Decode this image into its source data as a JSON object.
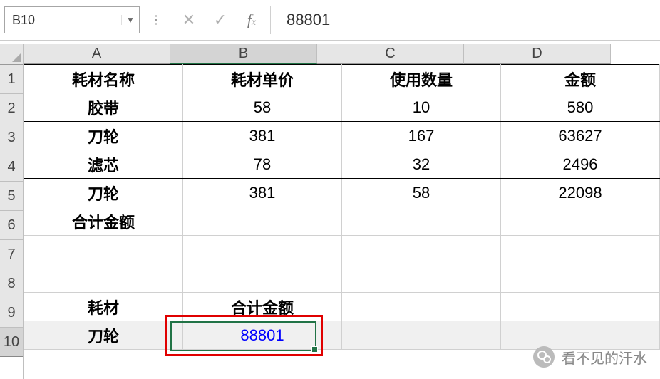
{
  "namebox": "B10",
  "formula_value": "88801",
  "col_labels": [
    "A",
    "B",
    "C",
    "D"
  ],
  "row_labels": [
    "1",
    "2",
    "3",
    "4",
    "5",
    "6",
    "7",
    "8",
    "9",
    "10"
  ],
  "selected_col": "B",
  "selected_row": "10",
  "hdr": {
    "a": "耗材名称",
    "b": "耗材单价",
    "c": "使用数量",
    "d": "金额"
  },
  "rows": [
    {
      "a": "胶带",
      "b": "58",
      "c": "10",
      "d": "580"
    },
    {
      "a": "刀轮",
      "b": "381",
      "c": "167",
      "d": "63627"
    },
    {
      "a": "滤芯",
      "b": "78",
      "c": "32",
      "d": "2496"
    },
    {
      "a": "刀轮",
      "b": "381",
      "c": "58",
      "d": "22098"
    }
  ],
  "row6_a": "合计金额",
  "row9": {
    "a": "耗材",
    "b": "合计金额"
  },
  "row10": {
    "a": "刀轮",
    "b": "88801"
  },
  "watermark": "看不见的汗水"
}
